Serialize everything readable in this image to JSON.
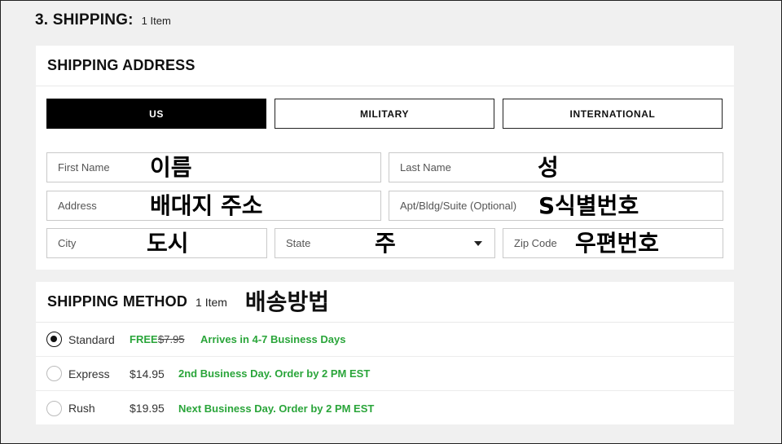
{
  "section": {
    "title": "3. SHIPPING:",
    "count": "1 Item"
  },
  "address": {
    "title": "SHIPPING ADDRESS",
    "tabs": [
      {
        "label": "US",
        "active": true
      },
      {
        "label": "MILITARY",
        "active": false
      },
      {
        "label": "INTERNATIONAL",
        "active": false
      }
    ],
    "fields": {
      "first_name": {
        "label": "First Name",
        "note": "이름"
      },
      "last_name": {
        "label": "Last Name",
        "note": "성"
      },
      "address": {
        "label": "Address",
        "note": "배대지 주소"
      },
      "apt": {
        "label": "Apt/Bldg/Suite (Optional)",
        "note": "S식별번호"
      },
      "city": {
        "label": "City",
        "note": "도시"
      },
      "state": {
        "label": "State",
        "note": "주"
      },
      "zip": {
        "label": "Zip Code",
        "note": "우편번호"
      }
    }
  },
  "method": {
    "title": "SHIPPING METHOD",
    "count": "1 Item",
    "note": "배송방법",
    "options": [
      {
        "name": "Standard",
        "free": "FREE",
        "old_price": "$7.95",
        "desc": "Arrives in 4-7 Business Days",
        "checked": true
      },
      {
        "name": "Express",
        "price": "$14.95",
        "desc": "2nd Business Day. Order by 2 PM EST",
        "checked": false
      },
      {
        "name": "Rush",
        "price": "$19.95",
        "desc": "Next Business Day. Order by 2 PM EST",
        "checked": false
      }
    ]
  }
}
